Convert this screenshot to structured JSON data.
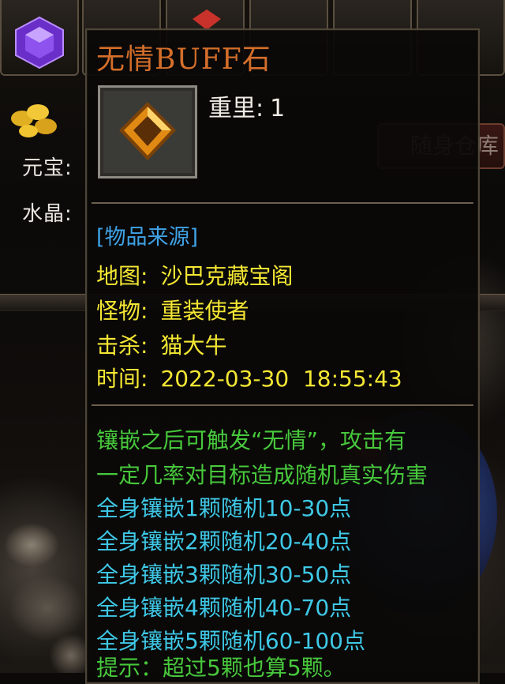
{
  "background": {
    "currency": {
      "yuanbao_label": "元宝:",
      "crystal_label": "水晶:"
    },
    "warehouse_button": "随身仓库"
  },
  "tooltip": {
    "title": "无情BUFF石",
    "weight_label": "重里:",
    "weight_value": "1",
    "source_heading": "[物品来源]",
    "source": [
      {
        "key": "地图:",
        "value": "沙巴克藏宝阁"
      },
      {
        "key": "怪物:",
        "value": "重装使者"
      },
      {
        "key": "击杀:",
        "value": "猫大牛"
      },
      {
        "key": "时间:",
        "value": "2022-03-30  18:55:43"
      }
    ],
    "description": [
      "镶嵌之后可触发“无情”，攻击有",
      "一定几率对目标造成随机真实伤害"
    ],
    "bonuses": [
      "全身镶嵌1颗随机10-30点",
      "全身镶嵌2颗随机20-40点",
      "全身镶嵌3颗随机30-50点",
      "全身镶嵌4颗随机40-70点",
      "全身镶嵌5颗随机60-100点"
    ],
    "tip": "提示：超过5颗也算5颗。"
  },
  "colors": {
    "title": "#d46e2a",
    "source_heading": "#3fa2e6",
    "info": "#f4e733",
    "description": "#47c83c",
    "bonus": "#3fc8e6"
  },
  "icons": [
    "purple-gem-icon",
    "gold-coins-icon",
    "buff-stone-icon"
  ]
}
